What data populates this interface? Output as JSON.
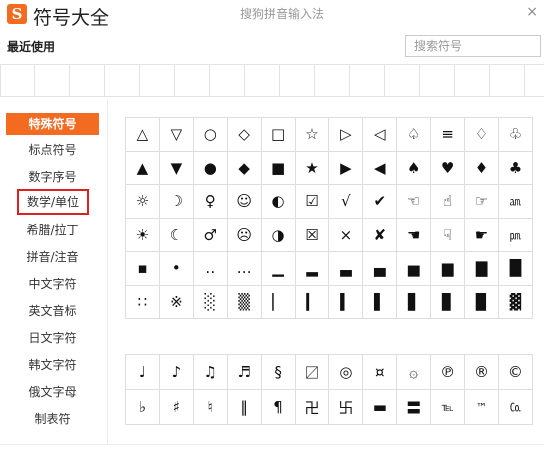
{
  "titlebar": {
    "logo": "S",
    "title": "符号大全",
    "ime_name": "搜狗拼音输入法",
    "close": "×"
  },
  "recent": {
    "label": "最近使用",
    "search_placeholder": "搜索符号",
    "cells": 15
  },
  "sidebar": {
    "items": [
      {
        "label": "特殊符号",
        "active": true
      },
      {
        "label": "标点符号"
      },
      {
        "label": "数字序号"
      },
      {
        "label": "数学/单位",
        "highlighted": true
      },
      {
        "label": "希腊/拉丁"
      },
      {
        "label": "拼音/注音"
      },
      {
        "label": "中文字符"
      },
      {
        "label": "英文音标"
      },
      {
        "label": "日文字符"
      },
      {
        "label": "韩文字符"
      },
      {
        "label": "俄文字母"
      },
      {
        "label": "制表符"
      }
    ]
  },
  "grid1": [
    [
      "△",
      "▽",
      "○",
      "◇",
      "□",
      "☆",
      "▷",
      "◁",
      "♤",
      "≡",
      "♢",
      "♧"
    ],
    [
      "▲",
      "▼",
      "●",
      "◆",
      "■",
      "★",
      "▶",
      "◀",
      "♠",
      "♥",
      "♦",
      "♣"
    ],
    [
      "☼",
      "☽",
      "♀",
      "☺",
      "◐",
      "☑",
      "√",
      "✔",
      "☜",
      "☝",
      "☞",
      "㏂"
    ],
    [
      "☀",
      "☾",
      "♂",
      "☹",
      "◑",
      "☒",
      "×",
      "✘",
      "☚",
      "☟",
      "☛",
      "㏘"
    ],
    [
      "▪",
      "•",
      "‥",
      "…",
      "▁",
      "▂",
      "▃",
      "▄",
      "▅",
      "▆",
      "▇",
      "█"
    ],
    [
      "∷",
      "※",
      "░",
      "▒",
      "▏",
      "▎",
      "▍",
      "▌",
      "▋",
      "▊",
      "▉",
      "▓"
    ]
  ],
  "grid2": [
    [
      "♩",
      "♪",
      "♫",
      "♬",
      "§",
      "〼",
      "◎",
      "¤",
      "۞",
      "℗",
      "®",
      "©"
    ],
    [
      "♭",
      "♯",
      "♮",
      "‖",
      "¶",
      "卍",
      "卐",
      "▬",
      "〓",
      "℡",
      "™",
      "㏇"
    ]
  ]
}
